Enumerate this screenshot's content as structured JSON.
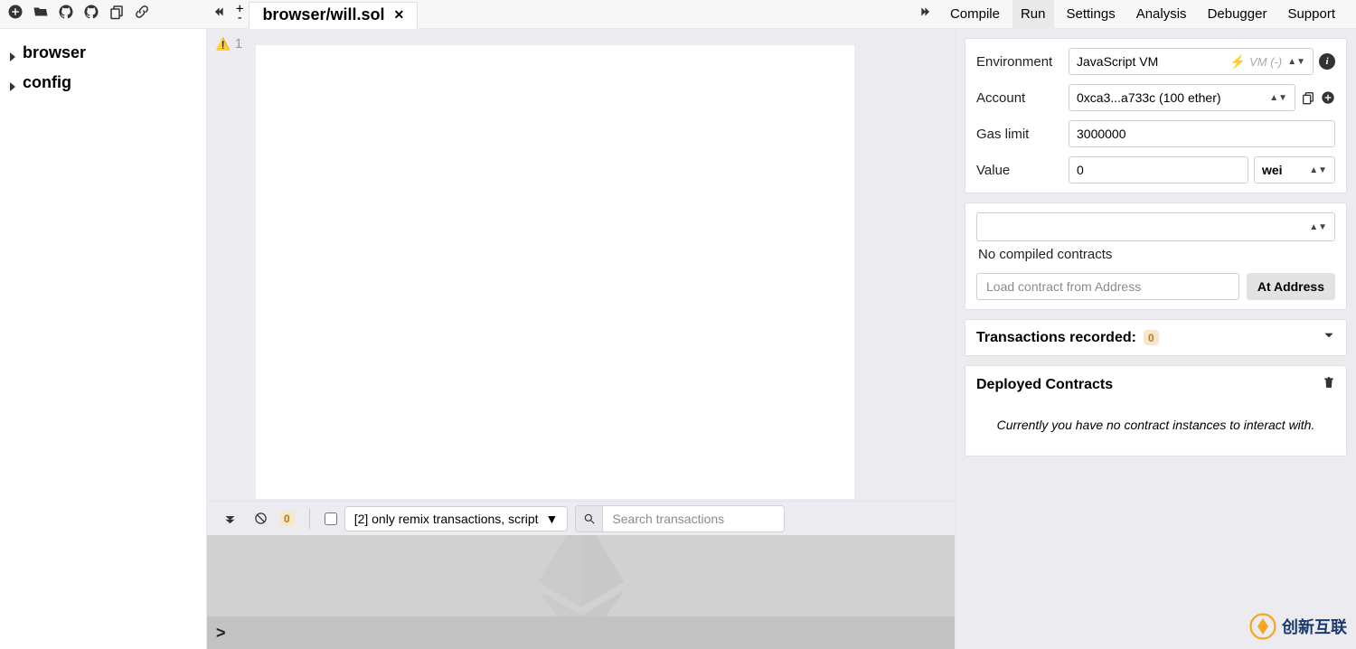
{
  "toolbar_icons": [
    "plus-circle",
    "folder-open",
    "github",
    "github",
    "copy",
    "link"
  ],
  "open_file": "browser/will.sol",
  "nav_links": [
    "Compile",
    "Run",
    "Settings",
    "Analysis",
    "Debugger",
    "Support"
  ],
  "nav_active_index": 1,
  "file_tree": [
    {
      "label": "browser"
    },
    {
      "label": "config"
    }
  ],
  "editor": {
    "warn_lines": [
      "1"
    ],
    "gutter_lines": [
      "1"
    ]
  },
  "terminal": {
    "pending_count": "0",
    "filter_label": "[2] only remix transactions, script",
    "search_placeholder": "Search transactions",
    "prompt": ">"
  },
  "right_panel": {
    "env_label": "Environment",
    "env_value": "JavaScript VM",
    "vm_status": "VM (-)",
    "account_label": "Account",
    "account_value": "0xca3...a733c (100 ether)",
    "gas_label": "Gas limit",
    "gas_value": "3000000",
    "value_label": "Value",
    "value_value": "0",
    "value_unit": "wei",
    "contract_select": "",
    "no_compiled": "No compiled contracts",
    "load_placeholder": "Load contract from Address",
    "at_address": "At Address",
    "tx_recorded": "Transactions recorded:",
    "tx_count": "0",
    "deployed_label": "Deployed Contracts",
    "no_instances": "Currently you have no contract instances to interact with."
  },
  "watermark_text": "创新互联"
}
